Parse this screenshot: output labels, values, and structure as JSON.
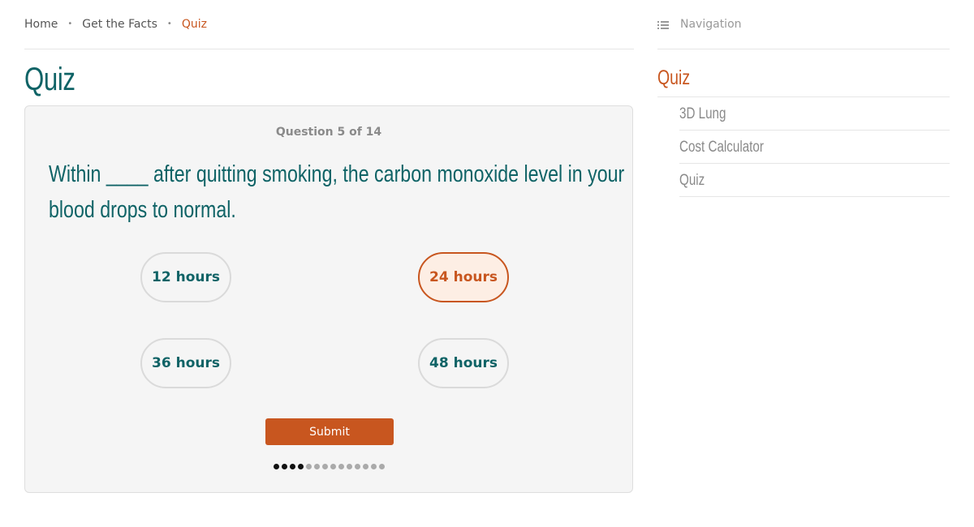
{
  "breadcrumb": {
    "items": [
      "Home",
      "Get the Facts",
      "Quiz"
    ],
    "separator": "•"
  },
  "page": {
    "title": "Quiz"
  },
  "quiz": {
    "counter": "Question 5 of 14",
    "question": "Within ____ after quitting smoking, the carbon monoxide level in your blood drops to normal.",
    "answers": [
      "12 hours",
      "24 hours",
      "36 hours",
      "48 hours"
    ],
    "selected_answer": "24 hours",
    "submit_label": "Submit",
    "current_question": 5,
    "total_questions": 14
  },
  "sidebar": {
    "header": "Navigation",
    "current": "Quiz",
    "items": [
      "3D Lung",
      "Cost Calculator",
      "Quiz"
    ]
  },
  "colors": {
    "accent": "#c8561f",
    "teal": "#0f6366",
    "muted": "#8a8a8a"
  }
}
